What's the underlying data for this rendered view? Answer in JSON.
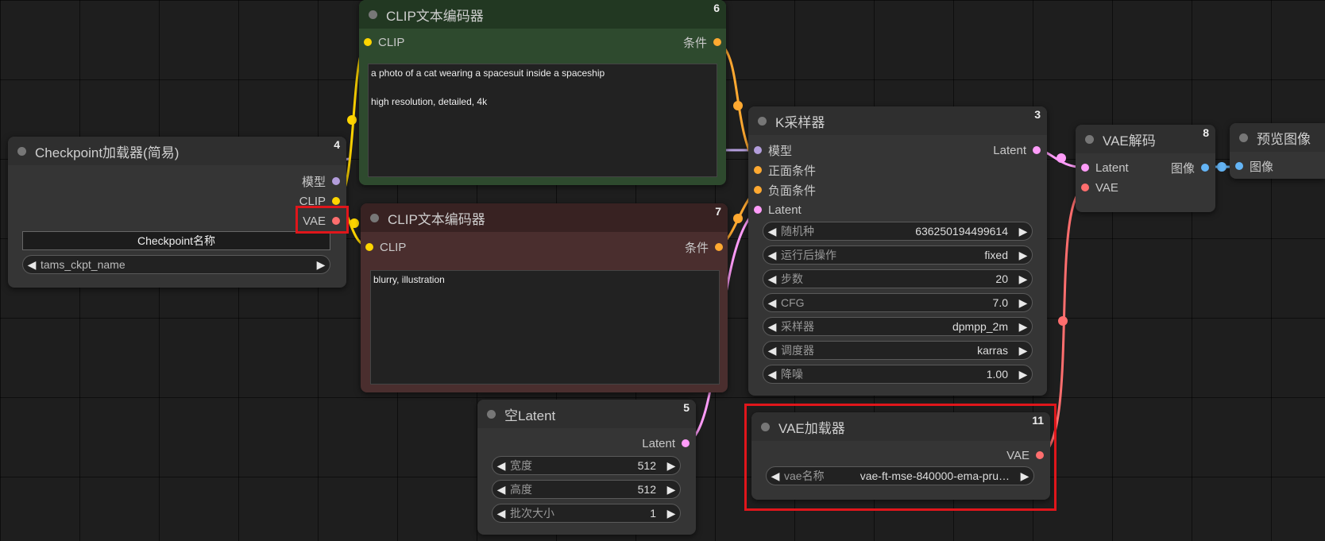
{
  "colors": {
    "clip": "#ffd500",
    "conditioning": "#ffa931",
    "model": "#b39ddb",
    "latent": "#ff9cf9",
    "vae": "#ff6e6e",
    "image": "#64b5f6",
    "green_node": "#2e4a2e",
    "red_node": "#4a2e2e",
    "highlight": "#e0161b"
  },
  "nodes": {
    "checkpoint": {
      "title": "Checkpoint加载器(简易)",
      "id": "4",
      "outputs": {
        "model": "模型",
        "clip": "CLIP",
        "vae": "VAE"
      },
      "widget_label": "Checkpoint名称",
      "widget_value": "tams_ckpt_name"
    },
    "clip_pos": {
      "title": "CLIP文本编码器",
      "id": "6",
      "input": "CLIP",
      "output": "条件",
      "text": "a photo of a cat wearing a spacesuit inside a spaceship\n\nhigh resolution, detailed, 4k"
    },
    "clip_neg": {
      "title": "CLIP文本编码器",
      "id": "7",
      "input": "CLIP",
      "output": "条件",
      "text": "blurry, illustration"
    },
    "empty_latent": {
      "title": "空Latent",
      "id": "5",
      "output": "Latent",
      "widgets": [
        {
          "label": "宽度",
          "value": "512"
        },
        {
          "label": "高度",
          "value": "512"
        },
        {
          "label": "批次大小",
          "value": "1"
        }
      ]
    },
    "ksampler": {
      "title": "K采样器",
      "id": "3",
      "inputs": [
        "模型",
        "正面条件",
        "负面条件",
        "Latent"
      ],
      "output": "Latent",
      "widgets": [
        {
          "label": "随机种",
          "value": "636250194499614"
        },
        {
          "label": "运行后操作",
          "value": "fixed"
        },
        {
          "label": "步数",
          "value": "20"
        },
        {
          "label": "CFG",
          "value": "7.0"
        },
        {
          "label": "采样器",
          "value": "dpmpp_2m"
        },
        {
          "label": "调度器",
          "value": "karras"
        },
        {
          "label": "降噪",
          "value": "1.00"
        }
      ]
    },
    "vae_decode": {
      "title": "VAE解码",
      "id": "8",
      "inputs": [
        "Latent",
        "VAE"
      ],
      "output": "图像"
    },
    "preview": {
      "title": "预览图像",
      "input": "图像"
    },
    "vae_loader": {
      "title": "VAE加载器",
      "id": "11",
      "output": "VAE",
      "widget_label": "vae名称",
      "widget_value": "vae-ft-mse-840000-ema-pru…"
    }
  },
  "arrows": {
    "left": "◀",
    "right": "▶"
  }
}
